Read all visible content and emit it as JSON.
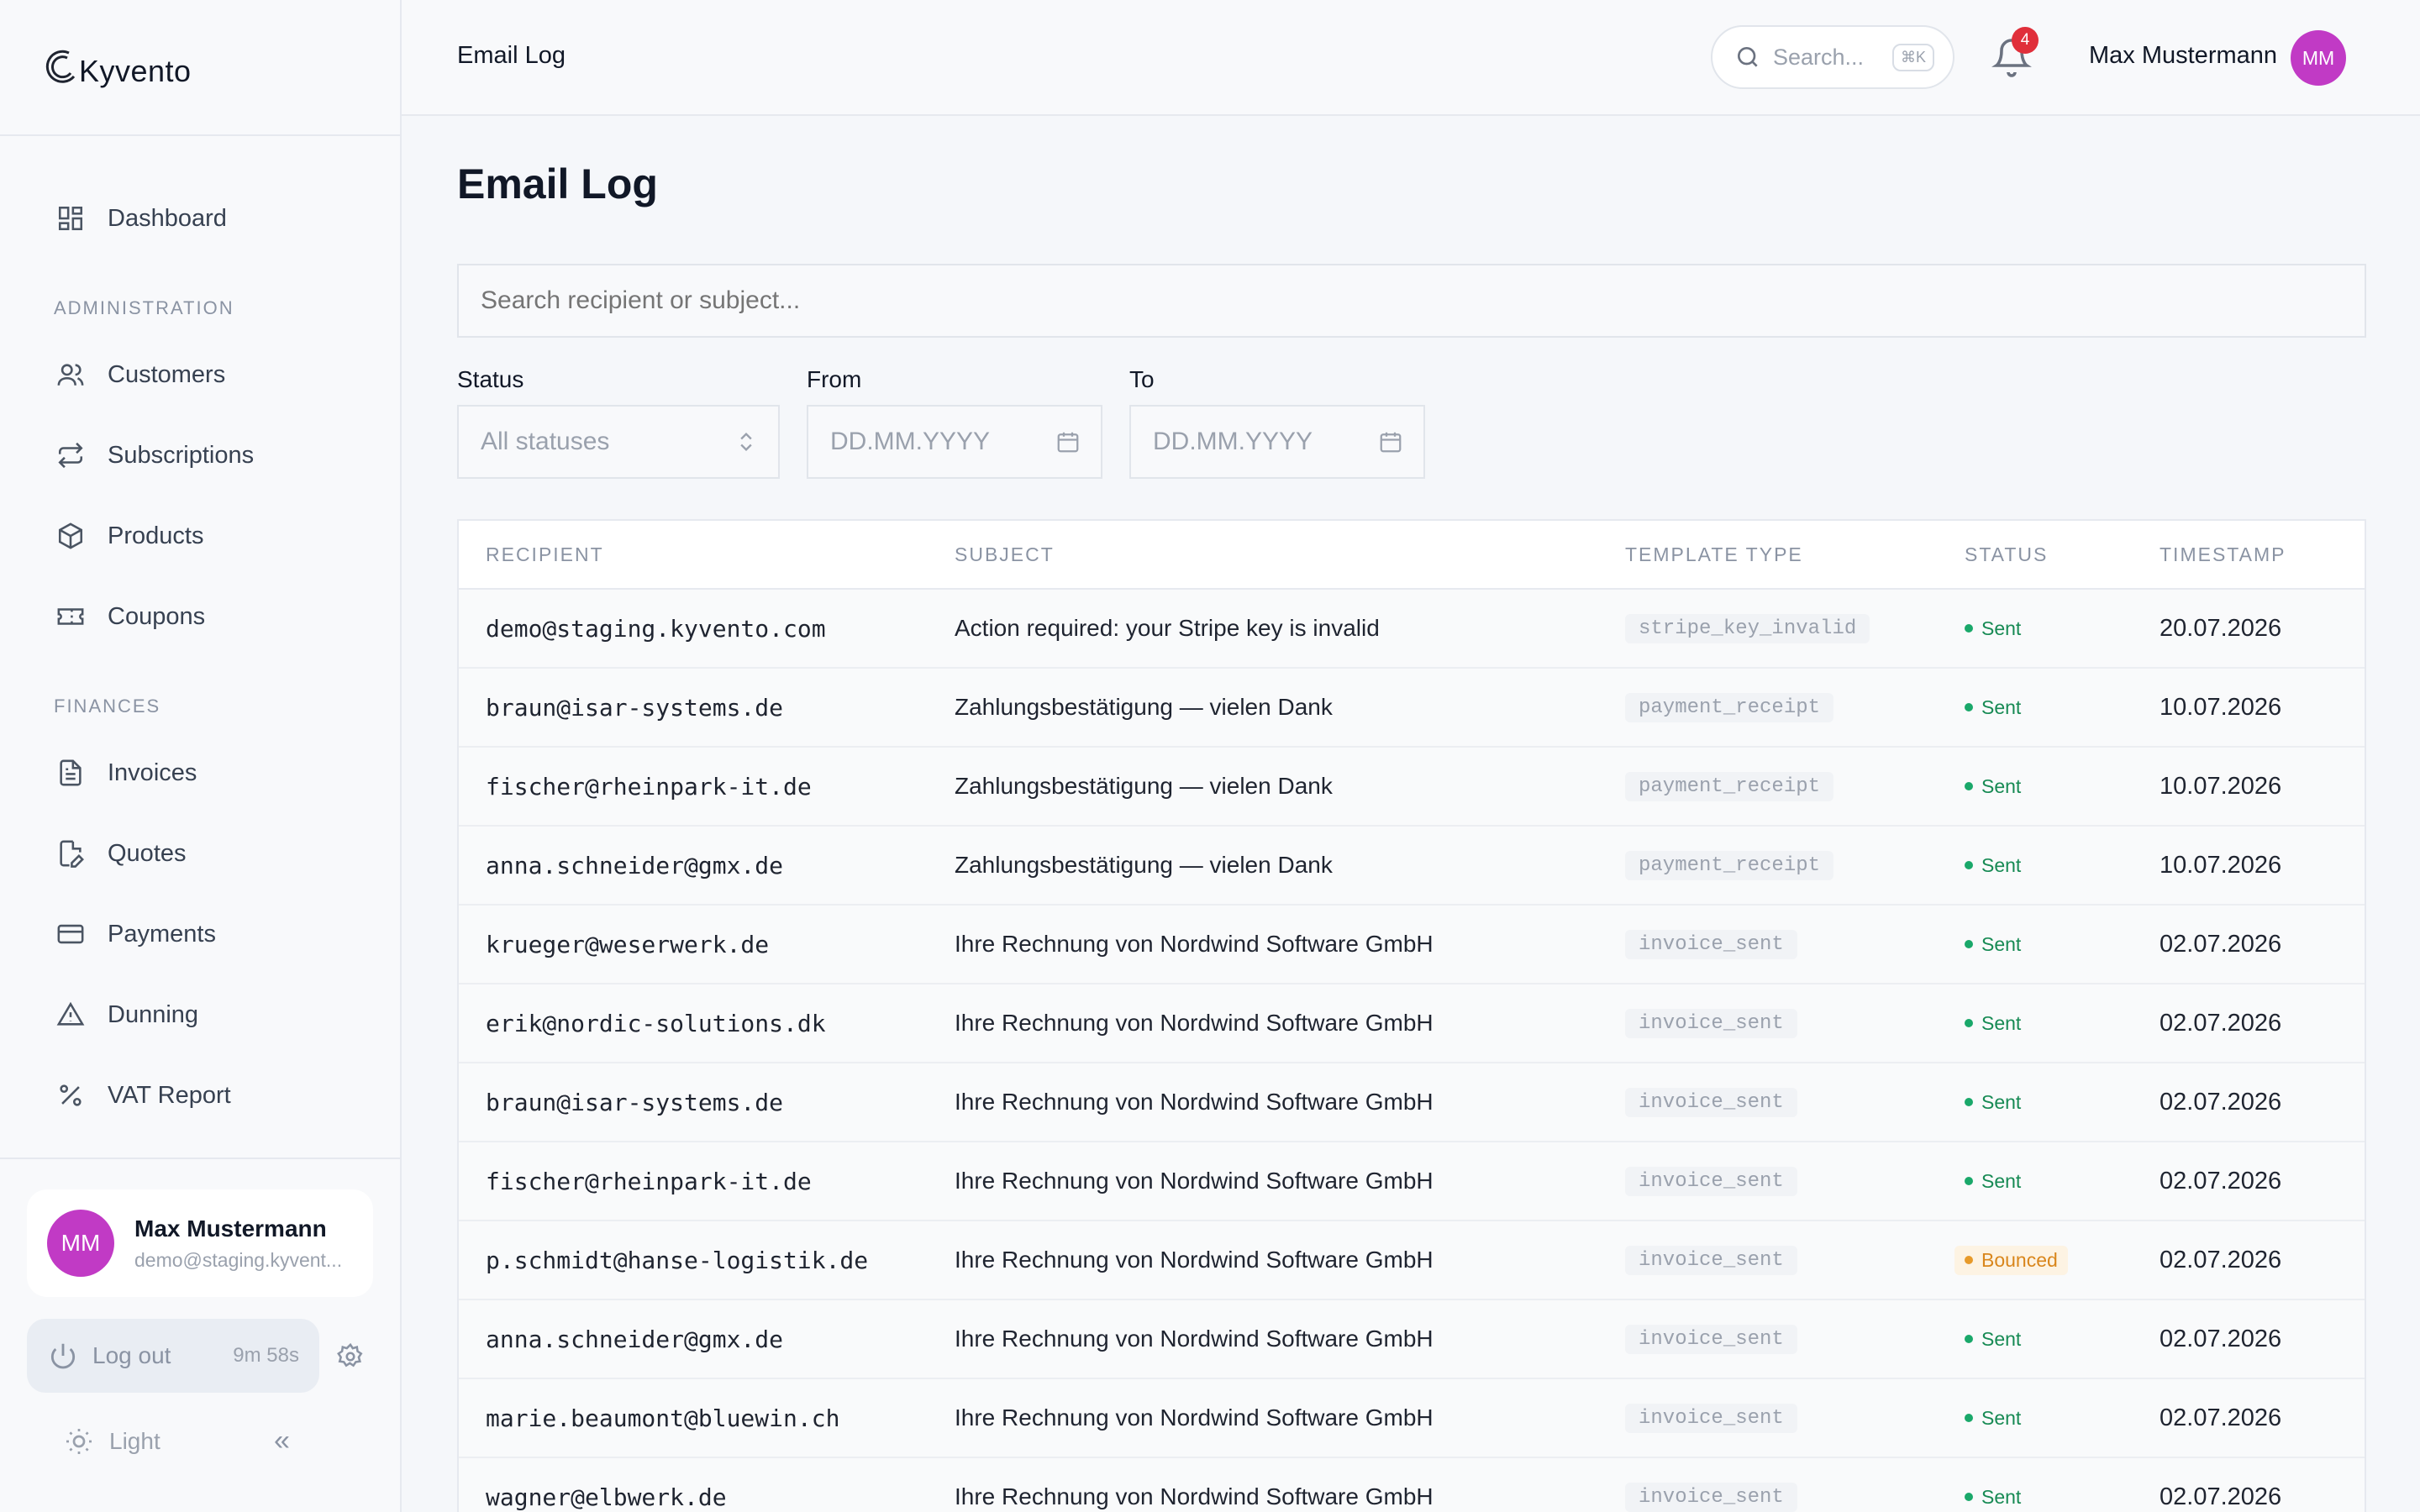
{
  "app": {
    "logo_text": "Kyvento",
    "page_title": "Email Log",
    "header_title": "Email Log"
  },
  "sidebar": {
    "dashboard": "Dashboard",
    "section_admin": "ADMINISTRATION",
    "customers": "Customers",
    "subscriptions": "Subscriptions",
    "products": "Products",
    "coupons": "Coupons",
    "section_finances": "FINANCES",
    "invoices": "Invoices",
    "quotes": "Quotes",
    "payments": "Payments",
    "dunning": "Dunning",
    "vat_report": "VAT Report",
    "user_initials": "MM",
    "user_name": "Max Mustermann",
    "user_email": "demo@staging.kyvent...",
    "logout_label": "Log out",
    "logout_timer": "9m 58s",
    "theme_label": "Light",
    "collapse_glyph": "«"
  },
  "topbar": {
    "search_placeholder": "Search...",
    "search_shortcut": "⌘K",
    "notification_count": "4",
    "user_name": "Max Mustermann",
    "user_initials": "MM"
  },
  "filters": {
    "search_placeholder": "Search recipient or subject...",
    "status_label": "Status",
    "status_value": "All statuses",
    "from_label": "From",
    "from_placeholder": "DD.MM.YYYY",
    "to_label": "To",
    "to_placeholder": "DD.MM.YYYY"
  },
  "table": {
    "headers": {
      "recipient": "RECIPIENT",
      "subject": "SUBJECT",
      "template": "TEMPLATE TYPE",
      "status": "STATUS",
      "timestamp": "TIMESTAMP"
    },
    "rows": [
      {
        "recipient": "demo@staging.kyvento.com",
        "subject": "Action required: your Stripe key is invalid",
        "template": "stripe_key_invalid",
        "status": "Sent",
        "timestamp": "20.07.2026"
      },
      {
        "recipient": "braun@isar-systems.de",
        "subject": "Zahlungsbestätigung — vielen Dank",
        "template": "payment_receipt",
        "status": "Sent",
        "timestamp": "10.07.2026"
      },
      {
        "recipient": "fischer@rheinpark-it.de",
        "subject": "Zahlungsbestätigung — vielen Dank",
        "template": "payment_receipt",
        "status": "Sent",
        "timestamp": "10.07.2026"
      },
      {
        "recipient": "anna.schneider@gmx.de",
        "subject": "Zahlungsbestätigung — vielen Dank",
        "template": "payment_receipt",
        "status": "Sent",
        "timestamp": "10.07.2026"
      },
      {
        "recipient": "krueger@weserwerk.de",
        "subject": "Ihre Rechnung von Nordwind Software GmbH",
        "template": "invoice_sent",
        "status": "Sent",
        "timestamp": "02.07.2026"
      },
      {
        "recipient": "erik@nordic-solutions.dk",
        "subject": "Ihre Rechnung von Nordwind Software GmbH",
        "template": "invoice_sent",
        "status": "Sent",
        "timestamp": "02.07.2026"
      },
      {
        "recipient": "braun@isar-systems.de",
        "subject": "Ihre Rechnung von Nordwind Software GmbH",
        "template": "invoice_sent",
        "status": "Sent",
        "timestamp": "02.07.2026"
      },
      {
        "recipient": "fischer@rheinpark-it.de",
        "subject": "Ihre Rechnung von Nordwind Software GmbH",
        "template": "invoice_sent",
        "status": "Sent",
        "timestamp": "02.07.2026"
      },
      {
        "recipient": "p.schmidt@hanse-logistik.de",
        "subject": "Ihre Rechnung von Nordwind Software GmbH",
        "template": "invoice_sent",
        "status": "Bounced",
        "timestamp": "02.07.2026"
      },
      {
        "recipient": "anna.schneider@gmx.de",
        "subject": "Ihre Rechnung von Nordwind Software GmbH",
        "template": "invoice_sent",
        "status": "Sent",
        "timestamp": "02.07.2026"
      },
      {
        "recipient": "marie.beaumont@bluewin.ch",
        "subject": "Ihre Rechnung von Nordwind Software GmbH",
        "template": "invoice_sent",
        "status": "Sent",
        "timestamp": "02.07.2026"
      },
      {
        "recipient": "wagner@elbwerk.de",
        "subject": "Ihre Rechnung von Nordwind Software GmbH",
        "template": "invoice_sent",
        "status": "Sent",
        "timestamp": "02.07.2026"
      }
    ]
  },
  "colors": {
    "accent_avatar": "#c13ac5",
    "status_sent": "#178a54",
    "status_bounced": "#d9861c",
    "badge_red": "#e02f3a"
  }
}
